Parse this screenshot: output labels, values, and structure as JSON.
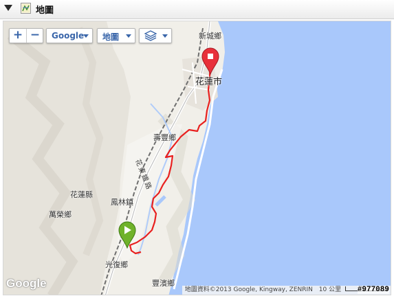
{
  "panel": {
    "title": "地圖",
    "toggle_icon": "triangle-down-icon",
    "title_icon": "map-icon"
  },
  "controls": {
    "zoom_in": "+",
    "zoom_out": "−",
    "provider": "Google",
    "map_type": "地圖",
    "layers_icon": "layers-icon"
  },
  "places": {
    "xincheng": "新城鄉",
    "hualien_city": "花蓮市",
    "shoufeng": "壽豐鄉",
    "hualien_county": "花蓮縣",
    "fenglin": "鳳林鎮",
    "wanrong": "萬榮鄉",
    "guangfu": "光復鄉",
    "fengbin": "豐濱鄉",
    "railway": "花東鐵路"
  },
  "footer": {
    "google_logo": "Google",
    "attribution": "地圖資料©2013 Google, Kingway, ZENRIN",
    "scale": "10 公里",
    "map_id": "#977089"
  },
  "route": {
    "color": "#e8201f",
    "start_marker_color": "#6fb22a",
    "end_marker_color": "#e8303a"
  },
  "colors": {
    "sea": "#a9c8fb",
    "land": "#f2f0ea",
    "accent": "#3a66aa"
  }
}
